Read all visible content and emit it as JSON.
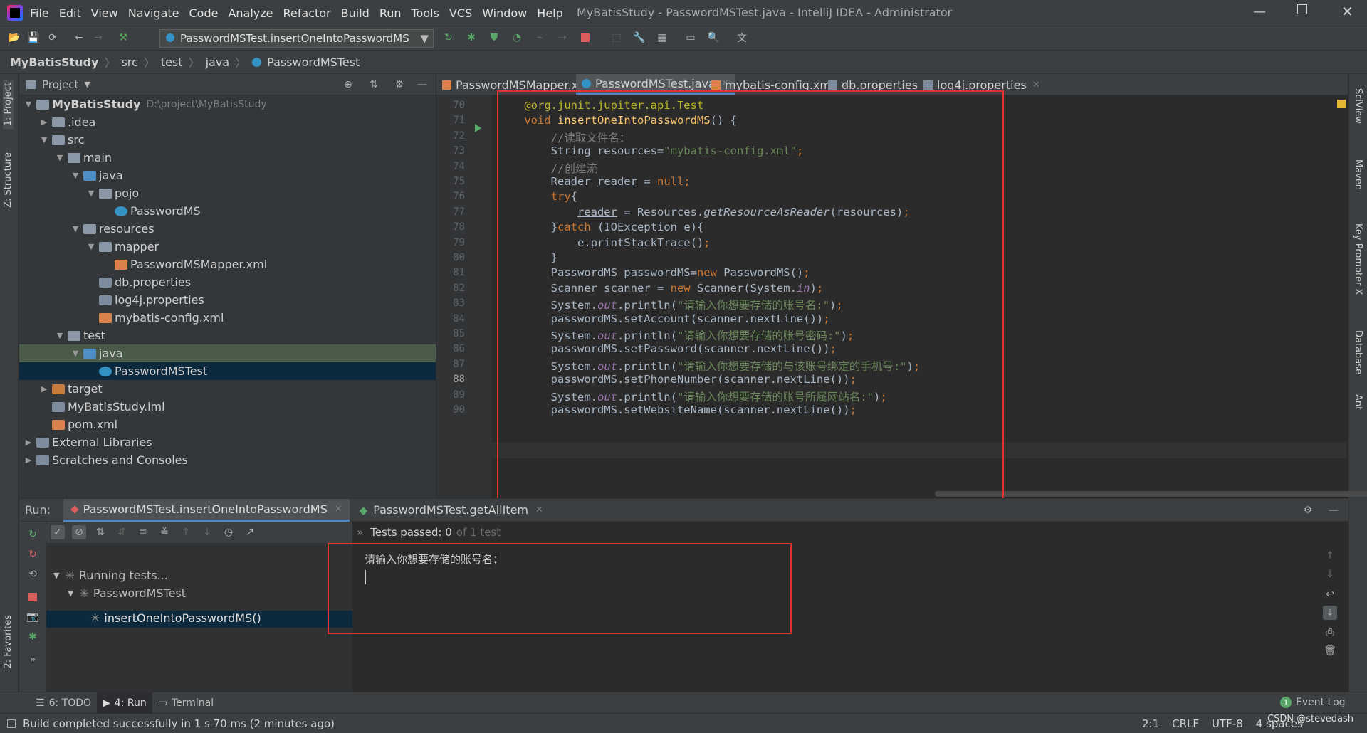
{
  "window": {
    "title": "MyBatisStudy - PasswordMSTest.java - IntelliJ IDEA - Administrator"
  },
  "menu": [
    "File",
    "Edit",
    "View",
    "Navigate",
    "Code",
    "Analyze",
    "Refactor",
    "Build",
    "Run",
    "Tools",
    "VCS",
    "Window",
    "Help"
  ],
  "toolbar": {
    "run_config": "PasswordMSTest.insertOneIntoPasswordMS"
  },
  "breadcrumb": [
    "MyBatisStudy",
    "src",
    "test",
    "java",
    "PasswordMSTest"
  ],
  "project": {
    "title": "Project",
    "tree": [
      {
        "label": "MyBatisStudy",
        "extra": "D:\\project\\MyBatisStudy",
        "depth": 0,
        "arrow": "▼",
        "icon": "folder"
      },
      {
        "label": ".idea",
        "depth": 1,
        "arrow": "▶",
        "icon": "folder"
      },
      {
        "label": "src",
        "depth": 1,
        "arrow": "▼",
        "icon": "folder"
      },
      {
        "label": "main",
        "depth": 2,
        "arrow": "▼",
        "icon": "folder"
      },
      {
        "label": "java",
        "depth": 3,
        "arrow": "▼",
        "icon": "folder-blue"
      },
      {
        "label": "pojo",
        "depth": 4,
        "arrow": "▼",
        "icon": "folder"
      },
      {
        "label": "PasswordMS",
        "depth": 5,
        "arrow": "",
        "icon": "file-class"
      },
      {
        "label": "resources",
        "depth": 3,
        "arrow": "▼",
        "icon": "folder"
      },
      {
        "label": "mapper",
        "depth": 4,
        "arrow": "▼",
        "icon": "folder"
      },
      {
        "label": "PasswordMSMapper.xml",
        "depth": 5,
        "arrow": "",
        "icon": "file-xml"
      },
      {
        "label": "db.properties",
        "depth": 4,
        "arrow": "",
        "icon": "file-prop"
      },
      {
        "label": "log4j.properties",
        "depth": 4,
        "arrow": "",
        "icon": "file-prop"
      },
      {
        "label": "mybatis-config.xml",
        "depth": 4,
        "arrow": "",
        "icon": "file-xml"
      },
      {
        "label": "test",
        "depth": 2,
        "arrow": "▼",
        "icon": "folder"
      },
      {
        "label": "java",
        "depth": 3,
        "arrow": "▼",
        "icon": "folder-blue",
        "hl": "sel2"
      },
      {
        "label": "PasswordMSTest",
        "depth": 4,
        "arrow": "",
        "icon": "file-class",
        "hl": "sel"
      },
      {
        "label": "target",
        "depth": 1,
        "arrow": "▶",
        "icon": "folder-orange"
      },
      {
        "label": "MyBatisStudy.iml",
        "depth": 1,
        "arrow": "",
        "icon": "file-prop"
      },
      {
        "label": "pom.xml",
        "depth": 1,
        "arrow": "",
        "icon": "file-xml"
      },
      {
        "label": "External Libraries",
        "depth": 0,
        "arrow": "▶",
        "icon": "file-prop"
      },
      {
        "label": "Scratches and Consoles",
        "depth": 0,
        "arrow": "▶",
        "icon": "file-prop"
      }
    ]
  },
  "tabs": [
    {
      "label": "PasswordMSMapper.xml",
      "active": false
    },
    {
      "label": "PasswordMSTest.java",
      "active": true
    },
    {
      "label": "mybatis-config.xml",
      "active": false
    },
    {
      "label": "db.properties",
      "active": false
    },
    {
      "label": "log4j.properties",
      "active": false
    }
  ],
  "code": {
    "line_numbers": [
      "70",
      "71",
      "72",
      "73",
      "74",
      "75",
      "76",
      "77",
      "78",
      "79",
      "80",
      "81",
      "82",
      "83",
      "84",
      "85",
      "86",
      "87",
      "88",
      "89",
      "90"
    ],
    "lines": [
      [
        {
          "t": "    "
        },
        {
          "t": "@org.junit.jupiter.api.Test",
          "c": "an"
        }
      ],
      [
        {
          "t": "    "
        },
        {
          "t": "void ",
          "c": "kw"
        },
        {
          "t": "insertOneIntoPasswordMS",
          "c": "fn"
        },
        {
          "t": "() {"
        }
      ],
      [
        {
          "t": "        "
        },
        {
          "t": "//读取文件名：",
          "c": "cm"
        }
      ],
      [
        {
          "t": "        String resources="
        },
        {
          "t": "\"mybatis-config.xml\"",
          "c": "st"
        },
        {
          "t": ";",
          "c": "kw"
        }
      ],
      [
        {
          "t": "        "
        },
        {
          "t": "//创建流",
          "c": "cm"
        }
      ],
      [
        {
          "t": "        Reader "
        },
        {
          "t": "reader",
          "c": "ul"
        },
        {
          "t": " = "
        },
        {
          "t": "null",
          "c": "kw"
        },
        {
          "t": ";",
          "c": "kw"
        }
      ],
      [
        {
          "t": "        "
        },
        {
          "t": "try",
          "c": "kw"
        },
        {
          "t": "{"
        }
      ],
      [
        {
          "t": "            "
        },
        {
          "t": "reader",
          "c": "ul"
        },
        {
          "t": " = Resources."
        },
        {
          "t": "getResourceAsReader",
          "c": "it"
        },
        {
          "t": "(resources)"
        },
        {
          "t": ";",
          "c": "kw"
        }
      ],
      [
        {
          "t": "        }"
        },
        {
          "t": "catch ",
          "c": "kw"
        },
        {
          "t": "(IOException e){"
        }
      ],
      [
        {
          "t": "            e.printStackTrace()"
        },
        {
          "t": ";",
          "c": "kw"
        }
      ],
      [
        {
          "t": "        }"
        }
      ],
      [
        {
          "t": "        PasswordMS passwordMS="
        },
        {
          "t": "new ",
          "c": "kw"
        },
        {
          "t": "PasswordMS()"
        },
        {
          "t": ";",
          "c": "kw"
        }
      ],
      [
        {
          "t": "        Scanner scanner = "
        },
        {
          "t": "new ",
          "c": "kw"
        },
        {
          "t": "Scanner(System."
        },
        {
          "t": "in",
          "c": "pu"
        },
        {
          "t": ")"
        },
        {
          "t": ";",
          "c": "kw"
        }
      ],
      [
        {
          "t": "        System."
        },
        {
          "t": "out",
          "c": "pu"
        },
        {
          "t": ".println("
        },
        {
          "t": "\"请输入你想要存储的账号名:\"",
          "c": "st"
        },
        {
          "t": ")"
        },
        {
          "t": ";",
          "c": "kw"
        }
      ],
      [
        {
          "t": "        passwordMS.setAccount(scanner.nextLine())"
        },
        {
          "t": ";",
          "c": "kw"
        }
      ],
      [
        {
          "t": "        System."
        },
        {
          "t": "out",
          "c": "pu"
        },
        {
          "t": ".println("
        },
        {
          "t": "\"请输入你想要存储的账号密码:\"",
          "c": "st"
        },
        {
          "t": ")"
        },
        {
          "t": ";",
          "c": "kw"
        }
      ],
      [
        {
          "t": "        passwordMS.setPassword(scanner.nextLine())"
        },
        {
          "t": ";",
          "c": "kw"
        }
      ],
      [
        {
          "t": "        System."
        },
        {
          "t": "out",
          "c": "pu"
        },
        {
          "t": ".println("
        },
        {
          "t": "\"请输入你想要存储的与该账号绑定的手机号:\"",
          "c": "st"
        },
        {
          "t": ")"
        },
        {
          "t": ";",
          "c": "kw"
        }
      ],
      [
        {
          "t": "        passwordMS.setPhoneNumber(scanner.nextLine())"
        },
        {
          "t": ";",
          "c": "kw"
        }
      ],
      [
        {
          "t": "        System."
        },
        {
          "t": "out",
          "c": "pu"
        },
        {
          "t": ".println("
        },
        {
          "t": "\"请输入你想要存储的账号所属网站名:\"",
          "c": "st"
        },
        {
          "t": ")"
        },
        {
          "t": ";",
          "c": "kw"
        }
      ],
      [
        {
          "t": "        passwordMS.setWebsiteName(scanner.nextLine())"
        },
        {
          "t": ";",
          "c": "kw"
        }
      ]
    ]
  },
  "run": {
    "label": "Run:",
    "tabs": [
      "PasswordMSTest.insertOneIntoPasswordMS",
      "PasswordMSTest.getAllItem"
    ],
    "status_prefix": "Tests passed: 0",
    "status_suffix": "of 1 test",
    "tree": [
      "Running tests...",
      "PasswordMSTest",
      "insertOneIntoPasswordMS()"
    ],
    "console_output": "请输入你想要存储的账号名："
  },
  "bottom_tabs": [
    "6: TODO",
    "4: Run",
    "Terminal"
  ],
  "event_log": "Event Log",
  "status": {
    "message": "Build completed successfully in 1 s 70 ms (2 minutes ago)",
    "position": "2:1",
    "line_sep": "CRLF",
    "encoding": "UTF-8",
    "indent": "4 spaces",
    "watermark": "CSDN @stevedash"
  },
  "left_strip": [
    "1: Project",
    "Z: Structure",
    "2: Favorites"
  ],
  "right_strip": [
    "SciView",
    "Maven",
    "Key Promoter X",
    "Database",
    "Ant"
  ]
}
